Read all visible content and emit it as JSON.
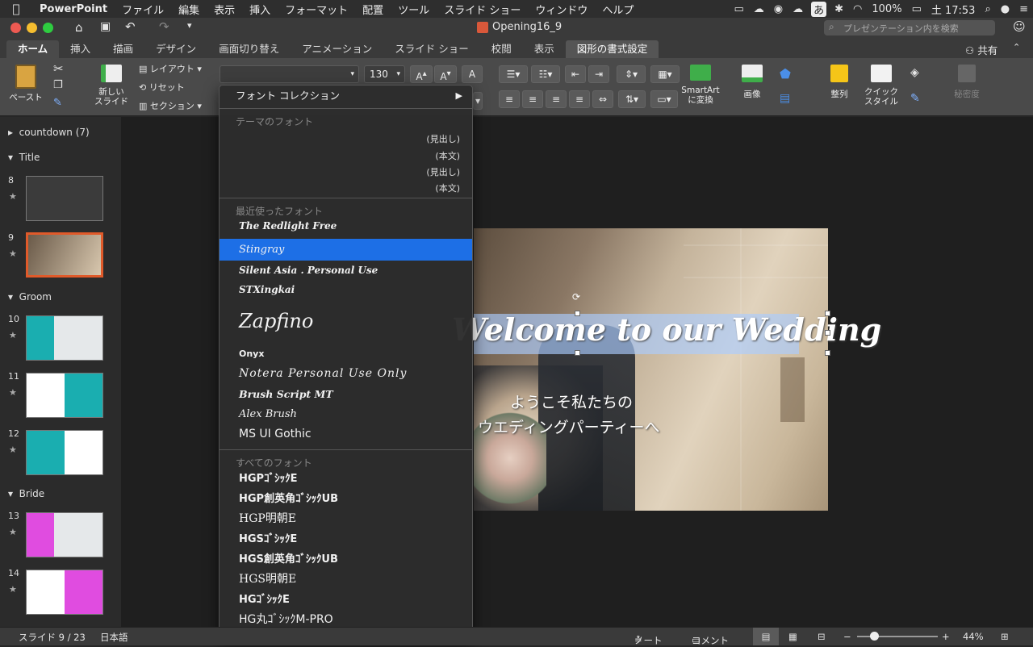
{
  "menubar": {
    "app": "PowerPoint",
    "items": [
      "ファイル",
      "編集",
      "表示",
      "挿入",
      "フォーマット",
      "配置",
      "ツール",
      "スライド ショー",
      "ウィンドウ",
      "ヘルプ"
    ],
    "ime": "あ",
    "battery": "100%",
    "clock": "土 17:53"
  },
  "titlebar": {
    "filename": "Opening16_9",
    "search_placeholder": "プレゼンテーション内を検索"
  },
  "tabs": [
    "ホーム",
    "挿入",
    "描画",
    "デザイン",
    "画面切り替え",
    "アニメーション",
    "スライド ショー",
    "校閲",
    "表示"
  ],
  "context_tab": "図形の書式設定",
  "share": "共有",
  "ribbon": {
    "paste": "ペースト",
    "new_slide": "新しい\nスライド",
    "layout": "レイアウト",
    "reset": "リセット",
    "section": "セクション",
    "font_size": "130",
    "smartart": "SmartArt\nに変換",
    "picture": "画像",
    "arrange": "整列",
    "quick_style": "クイック\nスタイル",
    "sensitivity": "秘密度"
  },
  "font_menu": {
    "collection": "フォント コレクション",
    "theme_header": "テーマのフォント",
    "theme_items": [
      "(見出し)",
      "(本文)",
      "(見出し)",
      "(本文)"
    ],
    "recent_header": "最近使ったフォント",
    "recent": [
      "The Redlight Free",
      "Stingray",
      "Silent Asia . Personal Use",
      "STXingkai",
      "Zapfino",
      "Onyx",
      "Notera Personal Use Only",
      "Brush Script MT",
      "Alex Brush",
      "MS UI Gothic"
    ],
    "selected_index": 1,
    "all_header": "すべてのフォント",
    "all": [
      "HGPｺﾞｼｯｸE",
      "HGP創英角ｺﾞｼｯｸUB",
      "HGP明朝E",
      "HGSｺﾞｼｯｸE",
      "HGS創英角ｺﾞｼｯｸUB",
      "HGS明朝E",
      "HGｺﾞｼｯｸE",
      "HG丸ｺﾞｼｯｸM-PRO"
    ]
  },
  "slides_pane": {
    "sections": [
      "countdown (7)",
      "Title",
      "Groom",
      "Bride"
    ],
    "slide_numbers": [
      "8",
      "9",
      "10",
      "11",
      "12",
      "13",
      "14"
    ]
  },
  "slide": {
    "title": "Welcome to our Wedding",
    "line1": "ようこそ私たちの",
    "line2": "ウエディングパーティーへ"
  },
  "status": {
    "slide_info": "スライド 9 / 23",
    "language": "日本語",
    "notes": "ノート",
    "comments": "コメント",
    "zoom": "44%"
  },
  "colors": {
    "accent": "#1d6fe6",
    "teal": "#1aaeb0",
    "magenta": "#e04ce0",
    "selected_border": "#e05a2a"
  }
}
